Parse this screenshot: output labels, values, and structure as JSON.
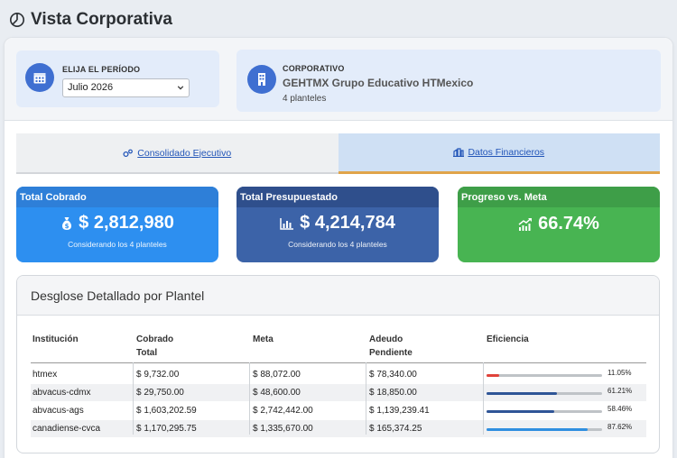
{
  "page": {
    "title": "Vista Corporativa"
  },
  "period": {
    "label": "ELIJA EL PERÍODO",
    "value": "Julio 2026"
  },
  "corporate": {
    "label": "CORPORATIVO",
    "name": "GEHTMX Grupo Educativo HTMexico",
    "count": "4 planteles"
  },
  "tabs": [
    {
      "label": "Consolidado Ejecutivo",
      "icon": "cogs-icon"
    },
    {
      "label": "Datos Financieros",
      "icon": "building-icon"
    }
  ],
  "stats": [
    {
      "title": "Total Cobrado",
      "value": "$ 2,812,980",
      "sub": "Considerando los 4 planteles",
      "icon": "money-bag-icon"
    },
    {
      "title": "Total Presupuestado",
      "value": "$ 4,214,784",
      "sub": "Considerando los 4 planteles",
      "icon": "bar-chart-icon"
    },
    {
      "title": "Progreso vs. Meta",
      "value": "66.74%",
      "sub": "",
      "icon": "trend-up-icon"
    }
  ],
  "detail": {
    "title": "Desglose Detallado por Plantel",
    "columns": [
      "Institución",
      "Cobrado Total",
      "Meta",
      "Adeudo Pendiente",
      "Eficiencia"
    ],
    "rows": [
      {
        "institucion": "htmex",
        "cobrado": "$ 9,732.00",
        "meta": "$ 88,072.00",
        "adeudo": "$ 78,340.00",
        "eficiencia": "11.05%",
        "fraction": 0.1105,
        "color": "#e0423a"
      },
      {
        "institucion": "abvacus-cdmx",
        "cobrado": "$ 29,750.00",
        "meta": "$ 48,600.00",
        "adeudo": "$ 18,850.00",
        "eficiencia": "61.21%",
        "fraction": 0.6121,
        "color": "#2f5597"
      },
      {
        "institucion": "abvacus-ags",
        "cobrado": "$ 1,603,202.59",
        "meta": "$ 2,742,442.00",
        "adeudo": "$ 1,139,239.41",
        "eficiencia": "58.46%",
        "fraction": 0.5846,
        "color": "#2f5597"
      },
      {
        "institucion": "canadiense-cvca",
        "cobrado": "$ 1,170,295.75",
        "meta": "$ 1,335,670.00",
        "adeudo": "$ 165,374.25",
        "eficiencia": "87.62%",
        "fraction": 0.8762,
        "color": "#2f8fe0"
      }
    ]
  }
}
